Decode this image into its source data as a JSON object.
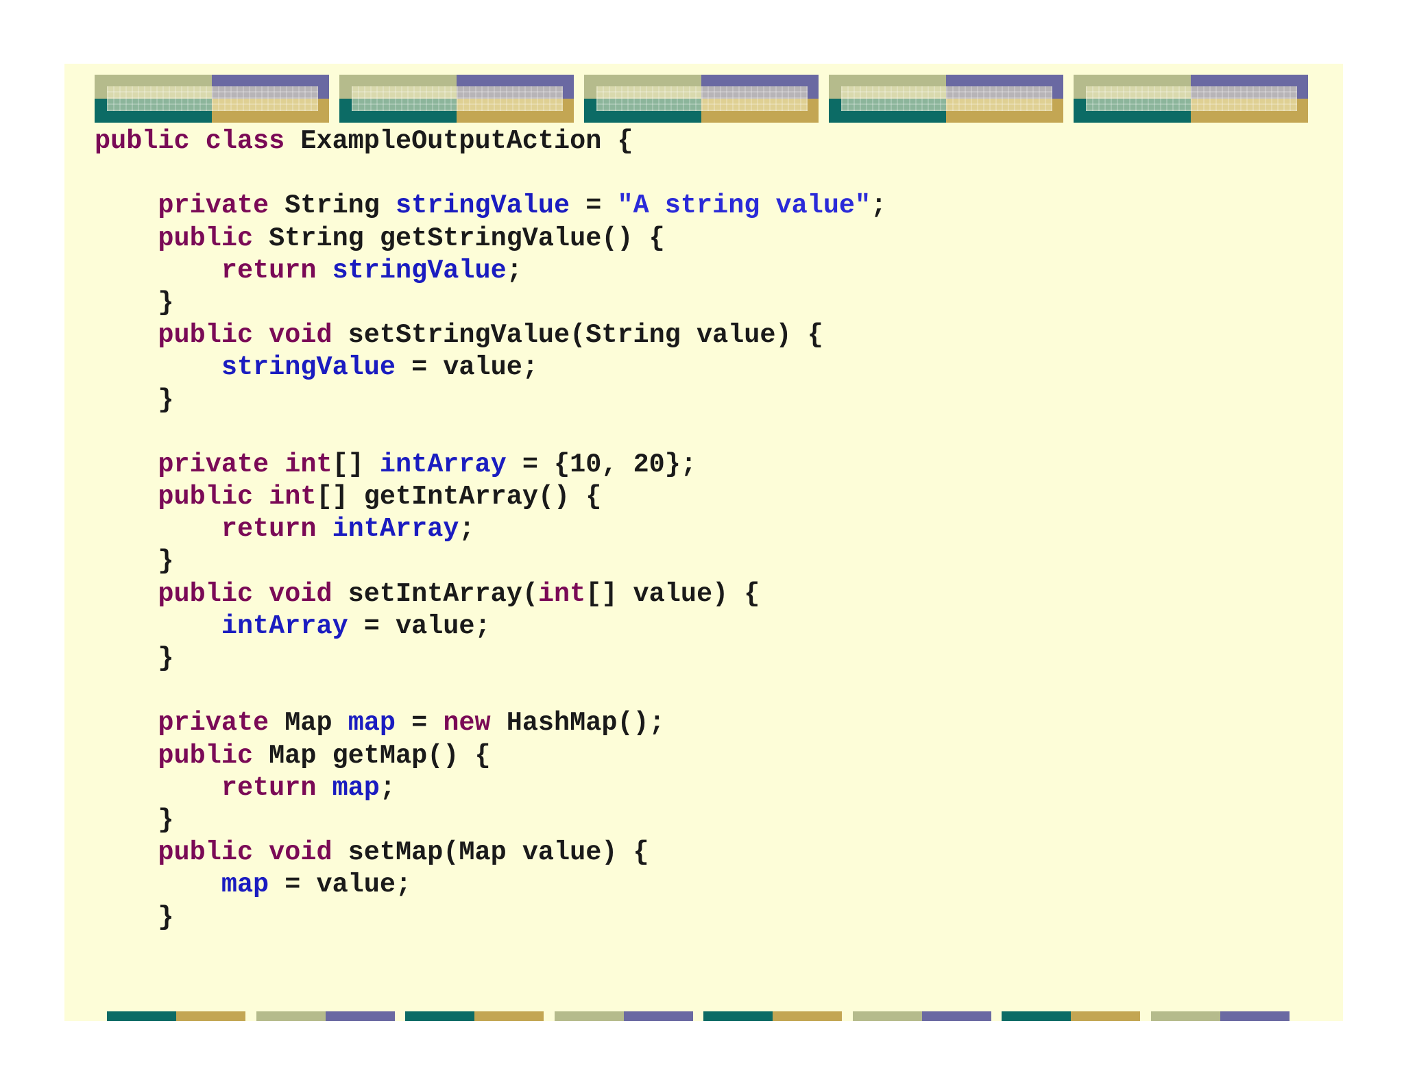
{
  "colors": {
    "background": "#fdfdd8",
    "keyword": "#7a0a56",
    "field": "#1a1cc0",
    "string": "#2a2ad8",
    "plain": "#1a1a1a",
    "teal": "#0c6b65",
    "gold": "#c3a653",
    "sage": "#b5bb8c",
    "slate": "#6a69a2"
  },
  "code_lines": [
    [
      {
        "t": "public class ",
        "c": "k"
      },
      {
        "t": "ExampleOutputAction {",
        "c": "p"
      }
    ],
    [],
    [
      {
        "t": "    "
      },
      {
        "t": "private",
        "c": "k"
      },
      {
        "t": " String "
      },
      {
        "t": "stringValue",
        "c": "f"
      },
      {
        "t": " = "
      },
      {
        "t": "\"A string value\"",
        "c": "s"
      },
      {
        "t": ";"
      }
    ],
    [
      {
        "t": "    "
      },
      {
        "t": "public",
        "c": "k"
      },
      {
        "t": " String getStringValue() {"
      }
    ],
    [
      {
        "t": "        "
      },
      {
        "t": "return",
        "c": "k"
      },
      {
        "t": " "
      },
      {
        "t": "stringValue",
        "c": "f"
      },
      {
        "t": ";"
      }
    ],
    [
      {
        "t": "    }"
      }
    ],
    [
      {
        "t": "    "
      },
      {
        "t": "public void",
        "c": "k"
      },
      {
        "t": " setStringValue(String value) {"
      }
    ],
    [
      {
        "t": "        "
      },
      {
        "t": "stringValue",
        "c": "f"
      },
      {
        "t": " = value;"
      }
    ],
    [
      {
        "t": "    }"
      }
    ],
    [],
    [
      {
        "t": "    "
      },
      {
        "t": "private int",
        "c": "k"
      },
      {
        "t": "[] "
      },
      {
        "t": "intArray",
        "c": "f"
      },
      {
        "t": " = {10, 20};"
      }
    ],
    [
      {
        "t": "    "
      },
      {
        "t": "public int",
        "c": "k"
      },
      {
        "t": "[] getIntArray() {"
      }
    ],
    [
      {
        "t": "        "
      },
      {
        "t": "return",
        "c": "k"
      },
      {
        "t": " "
      },
      {
        "t": "intArray",
        "c": "f"
      },
      {
        "t": ";"
      }
    ],
    [
      {
        "t": "    }"
      }
    ],
    [
      {
        "t": "    "
      },
      {
        "t": "public void",
        "c": "k"
      },
      {
        "t": " setIntArray("
      },
      {
        "t": "int",
        "c": "k"
      },
      {
        "t": "[] value) {"
      }
    ],
    [
      {
        "t": "        "
      },
      {
        "t": "intArray",
        "c": "f"
      },
      {
        "t": " = value;"
      }
    ],
    [
      {
        "t": "    }"
      }
    ],
    [],
    [
      {
        "t": "    "
      },
      {
        "t": "private",
        "c": "k"
      },
      {
        "t": " Map "
      },
      {
        "t": "map",
        "c": "f"
      },
      {
        "t": " = "
      },
      {
        "t": "new",
        "c": "k"
      },
      {
        "t": " HashMap();"
      }
    ],
    [
      {
        "t": "    "
      },
      {
        "t": "public",
        "c": "k"
      },
      {
        "t": " Map getMap() {"
      }
    ],
    [
      {
        "t": "        "
      },
      {
        "t": "return",
        "c": "k"
      },
      {
        "t": " "
      },
      {
        "t": "map",
        "c": "f"
      },
      {
        "t": ";"
      }
    ],
    [
      {
        "t": "    }"
      }
    ],
    [
      {
        "t": "    "
      },
      {
        "t": "public void",
        "c": "k"
      },
      {
        "t": " setMap(Map value) {"
      }
    ],
    [
      {
        "t": "        "
      },
      {
        "t": "map",
        "c": "f"
      },
      {
        "t": " = value;"
      }
    ],
    [
      {
        "t": "    }"
      }
    ]
  ]
}
